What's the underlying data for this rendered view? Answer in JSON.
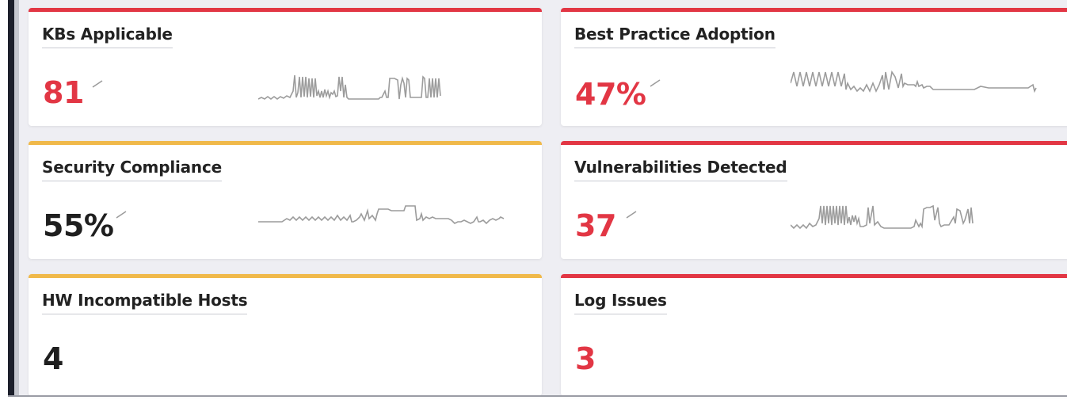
{
  "colors": {
    "red": "#e23644",
    "amber": "#f0b94a",
    "dark_text": "#1f1f1f",
    "spark": "#9c9c9c"
  },
  "cards": [
    {
      "title": "KBs Applicable",
      "value": "81",
      "status": "red",
      "has_trend": true,
      "icon": "trend-up-icon"
    },
    {
      "title": "Best Practice Adoption",
      "value": "47%",
      "status": "red",
      "has_trend": true,
      "icon": "trend-up-icon"
    },
    {
      "title": "Security Compliance",
      "value": "55%",
      "status": "amber",
      "has_trend": true,
      "icon": "trend-up-icon"
    },
    {
      "title": "Vulnerabilities Detected",
      "value": "37",
      "status": "red",
      "has_trend": true,
      "icon": "trend-up-icon"
    },
    {
      "title": "HW Incompatible Hosts",
      "value": "4",
      "status": "amber",
      "has_trend": false
    },
    {
      "title": "Log Issues",
      "value": "3",
      "status": "red",
      "has_trend": false
    }
  ]
}
